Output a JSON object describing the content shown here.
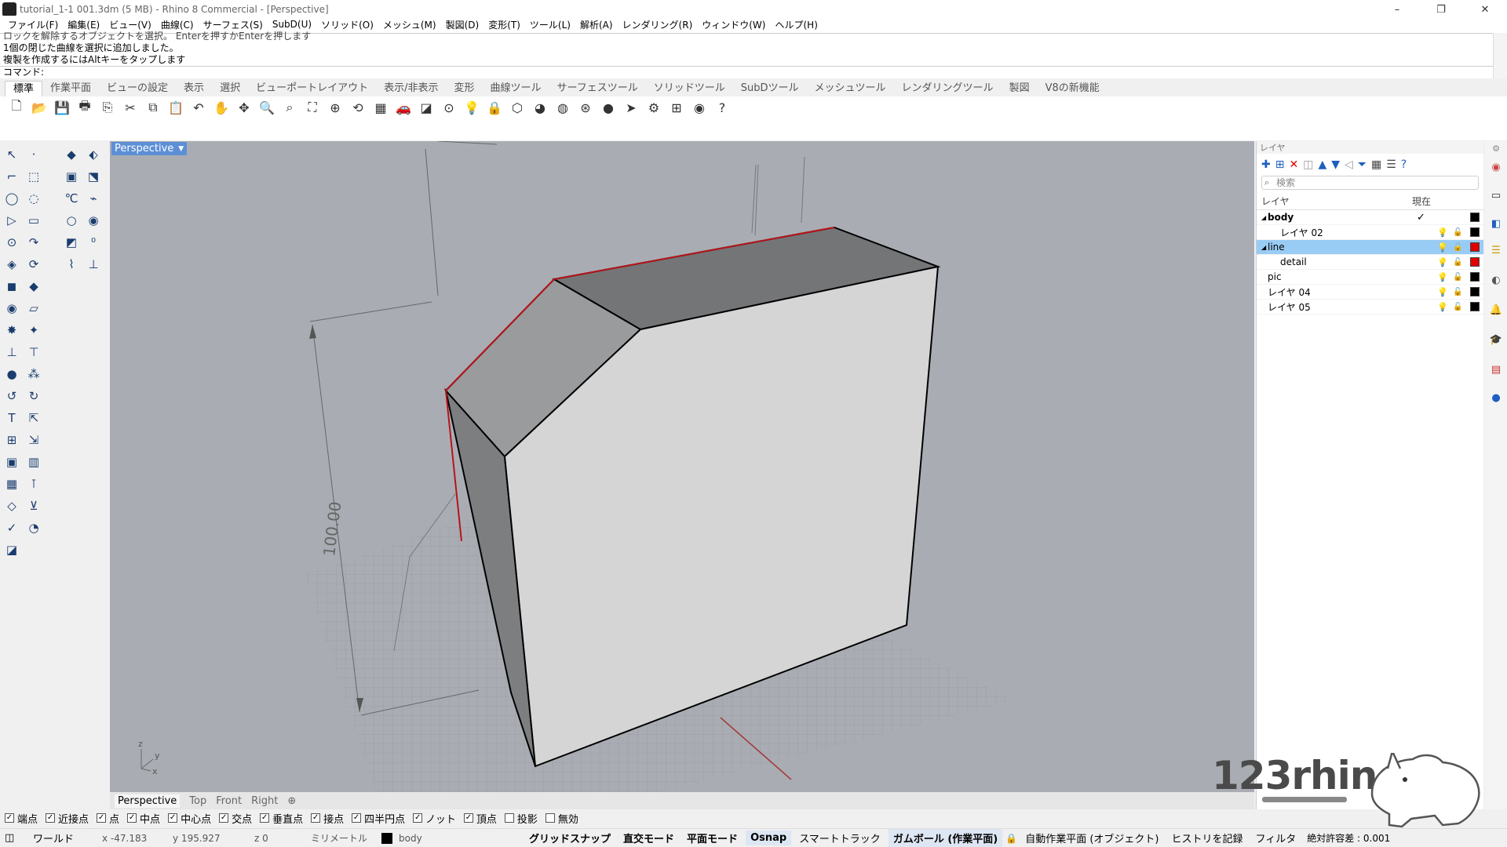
{
  "window": {
    "title": "tutorial_1-1 001.3dm (5 MB) - Rhino 8 Commercial - [Perspective]",
    "controls": [
      "–",
      "❐",
      "✕"
    ]
  },
  "menubar": [
    "ファイル(F)",
    "編集(E)",
    "ビュー(V)",
    "曲線(C)",
    "サーフェス(S)",
    "SubD(U)",
    "ソリッド(O)",
    "メッシュ(M)",
    "製図(D)",
    "変形(T)",
    "ツール(L)",
    "解析(A)",
    "レンダリング(R)",
    "ウィンドウ(W)",
    "ヘルプ(H)"
  ],
  "command_history": [
    "ロックを解除するオブジェクトを選択。 Enterを押すかEnterを押します",
    "1個の閉じた曲線を選択に追加しました。",
    "複製を作成するにはAltキーをタップします"
  ],
  "command_prompt": "コマンド:",
  "toolbar_tabs": [
    "標準",
    "作業平面",
    "ビューの設定",
    "表示",
    "選択",
    "ビューポートレイアウト",
    "表示/非表示",
    "変形",
    "曲線ツール",
    "サーフェスツール",
    "ソリッドツール",
    "SubDツール",
    "メッシュツール",
    "レンダリングツール",
    "製図",
    "V8の新機能"
  ],
  "toolbar_icons": [
    "new-file-icon",
    "open-file-icon",
    "save-icon",
    "print-icon",
    "import-icon",
    "cut-icon",
    "copy-icon",
    "paste-icon",
    "undo-icon",
    "pan-icon",
    "rotate-view-icon",
    "zoom-icon",
    "zoom-window-icon",
    "zoom-extents-icon",
    "zoom-selected-icon",
    "rotate-icon",
    "four-views-icon",
    "car-icon",
    "cplane-icon",
    "cplane-origin-icon",
    "bulb-icon",
    "lock-icon",
    "select-icon",
    "color-wheel-icon",
    "sphere-icon",
    "render-sphere-icon",
    "ball-icon",
    "pointer-icon",
    "gear-icon",
    "align-icon",
    "globe-icon",
    "help-icon"
  ],
  "viewport": {
    "name": "Perspective",
    "dimension": "100.00",
    "axis_labels": {
      "z": "z",
      "y": "y",
      "x": "x"
    }
  },
  "viewport_tabs": [
    "Perspective",
    "Top",
    "Front",
    "Right",
    "⊕"
  ],
  "layers_panel": {
    "title": "レイヤ",
    "search_placeholder": "検索",
    "col_layer": "レイヤ",
    "col_current": "現在",
    "rows": [
      {
        "name": "body",
        "bold": true,
        "expanded": true,
        "indent": 0,
        "current": true,
        "color": "#000000",
        "selected": false
      },
      {
        "name": "レイヤ 02",
        "indent": 2,
        "color": "#000000",
        "selected": false
      },
      {
        "name": "line",
        "expanded": true,
        "indent": 0,
        "color": "#e00000",
        "selected": true
      },
      {
        "name": "detail",
        "indent": 2,
        "color": "#e00000",
        "selected": false
      },
      {
        "name": "pic",
        "indent": 1,
        "color": "#000000",
        "selected": false
      },
      {
        "name": "レイヤ 04",
        "indent": 1,
        "color": "#000000",
        "selected": false
      },
      {
        "name": "レイヤ 05",
        "indent": 1,
        "color": "#000000",
        "selected": false
      }
    ]
  },
  "osnap": [
    {
      "label": "端点",
      "checked": true
    },
    {
      "label": "近接点",
      "checked": true
    },
    {
      "label": "点",
      "checked": true
    },
    {
      "label": "中点",
      "checked": true
    },
    {
      "label": "中心点",
      "checked": true
    },
    {
      "label": "交点",
      "checked": true
    },
    {
      "label": "垂直点",
      "checked": true
    },
    {
      "label": "接点",
      "checked": true
    },
    {
      "label": "四半円点",
      "checked": true
    },
    {
      "label": "ノット",
      "checked": true
    },
    {
      "label": "頂点",
      "checked": true
    },
    {
      "label": "投影",
      "checked": false
    },
    {
      "label": "無効",
      "checked": false
    }
  ],
  "status": {
    "cplane": "ワールド",
    "x": "x -47.183",
    "y": "y 195.927",
    "z": "z 0",
    "units": "ミリメートル",
    "layer": "body",
    "grid_snap": "グリッドスナップ",
    "ortho": "直交モード",
    "planar": "平面モード",
    "osnap": "Osnap",
    "smarttrack": "スマートトラック",
    "gumball": "ガムボール (作業平面)",
    "auto_cplane": "自動作業平面 (オブジェクト)",
    "history": "ヒストリを記録",
    "filter": "フィルタ",
    "tolerance": "絶対許容差 : 0.001"
  },
  "watermark": "123rhino",
  "colors": {
    "viewport_bg": "#a9adb3",
    "selection_blue": "#99ccf5",
    "viewport_title": "#5c8fd6",
    "red_edge": "#c0000b"
  }
}
